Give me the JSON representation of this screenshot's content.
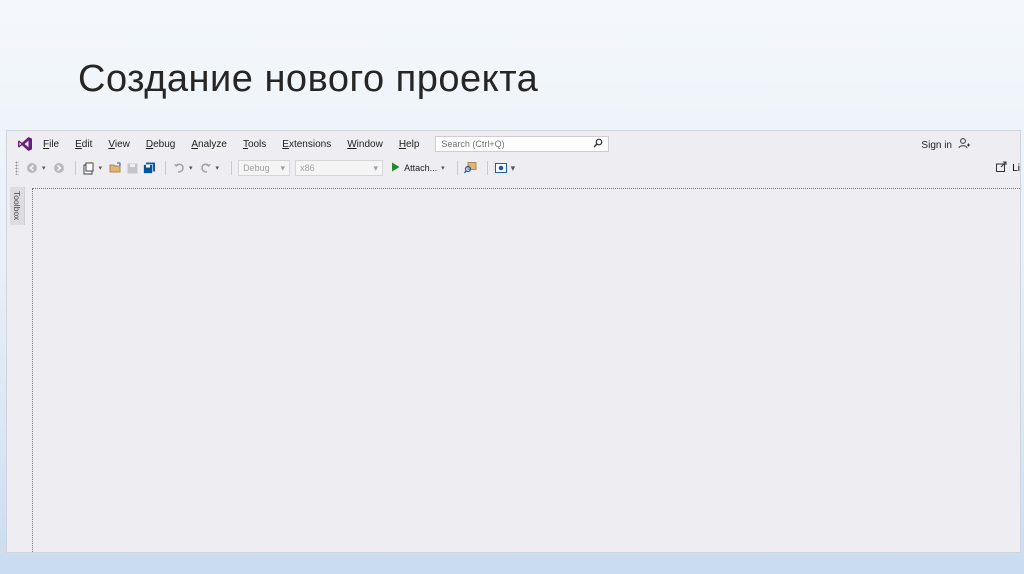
{
  "slide": {
    "title": "Создание нового проекта"
  },
  "menubar": {
    "logo_icon": "visual-studio-logo-icon",
    "items": [
      {
        "label": "File"
      },
      {
        "label": "Edit"
      },
      {
        "label": "View"
      },
      {
        "label": "Debug"
      },
      {
        "label": "Analyze"
      },
      {
        "label": "Tools"
      },
      {
        "label": "Extensions"
      },
      {
        "label": "Window"
      },
      {
        "label": "Help"
      }
    ],
    "search_placeholder": "Search (Ctrl+Q)",
    "sign_in": "Sign in"
  },
  "toolbar": {
    "configuration": "Debug",
    "platform": "x86",
    "attach_label": "Attach...",
    "live_share_label": "Li"
  },
  "toolbox": {
    "label": "Toolbox"
  },
  "colors": {
    "accent": "#68217a",
    "play": "#1e8c2a"
  }
}
